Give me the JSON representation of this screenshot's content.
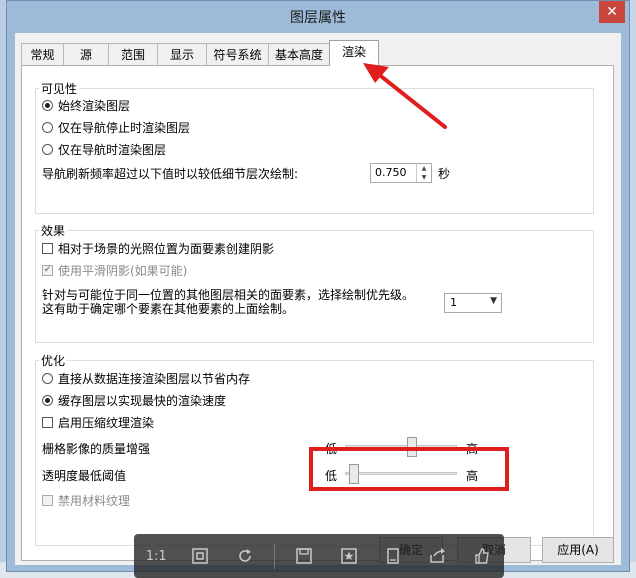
{
  "window": {
    "title": "图层属性",
    "close_glyph": "✕"
  },
  "tabs": [
    {
      "label": "常规"
    },
    {
      "label": "源"
    },
    {
      "label": "范围"
    },
    {
      "label": "显示"
    },
    {
      "label": "符号系统"
    },
    {
      "label": "基本高度"
    },
    {
      "label": "渲染",
      "active": true
    }
  ],
  "visibility": {
    "title": "可见性",
    "options": [
      "始终渲染图层",
      "仅在导航停止时渲染图层",
      "仅在导航时渲染图层"
    ],
    "selected_index": 0,
    "refresh_label": "导航刷新频率超过以下值时以较低细节层次绘制:",
    "refresh_value": "0.750",
    "refresh_unit": "秒"
  },
  "effects": {
    "title": "效果",
    "shadow_label": "相对于场景的光照位置为面要素创建阴影",
    "shadow_checked": false,
    "smooth_label": "使用平滑阴影(如果可能)",
    "smooth_checked": true,
    "smooth_disabled": true,
    "priority_line1": "针对与可能位于同一位置的其他图层相关的面要素，选择绘制优先级。",
    "priority_line2": "这有助于确定哪个要素在其他要素的上面绘制。",
    "priority_value": "1"
  },
  "optimize": {
    "title": "优化",
    "options": [
      "直接从数据连接渲染图层以节省内存",
      "缓存图层以实现最快的渲染速度"
    ],
    "selected_index": 1,
    "compress_label": "启用压缩纹理渲染",
    "compress_checked": false,
    "quality_label": "栅格影像的质量增强",
    "quality_low": "低",
    "quality_high": "高",
    "quality_level": 0.6,
    "alpha_label": "透明度最低阈值",
    "alpha_low": "低",
    "alpha_high": "高",
    "alpha_level": 0.08,
    "material_label": "禁用材料纹理",
    "material_checked": false,
    "material_disabled": true
  },
  "buttons": {
    "ok": "确定",
    "cancel": "取消",
    "apply": "应用(A)"
  },
  "viewer_toolbar": {
    "zoom_label": "1:1",
    "icons": [
      "fit-screen-icon",
      "rotate-icon",
      "save-icon",
      "favorite-icon",
      "copy-icon",
      "share-icon",
      "like-icon"
    ]
  },
  "annotation_color": "#e01e1e"
}
